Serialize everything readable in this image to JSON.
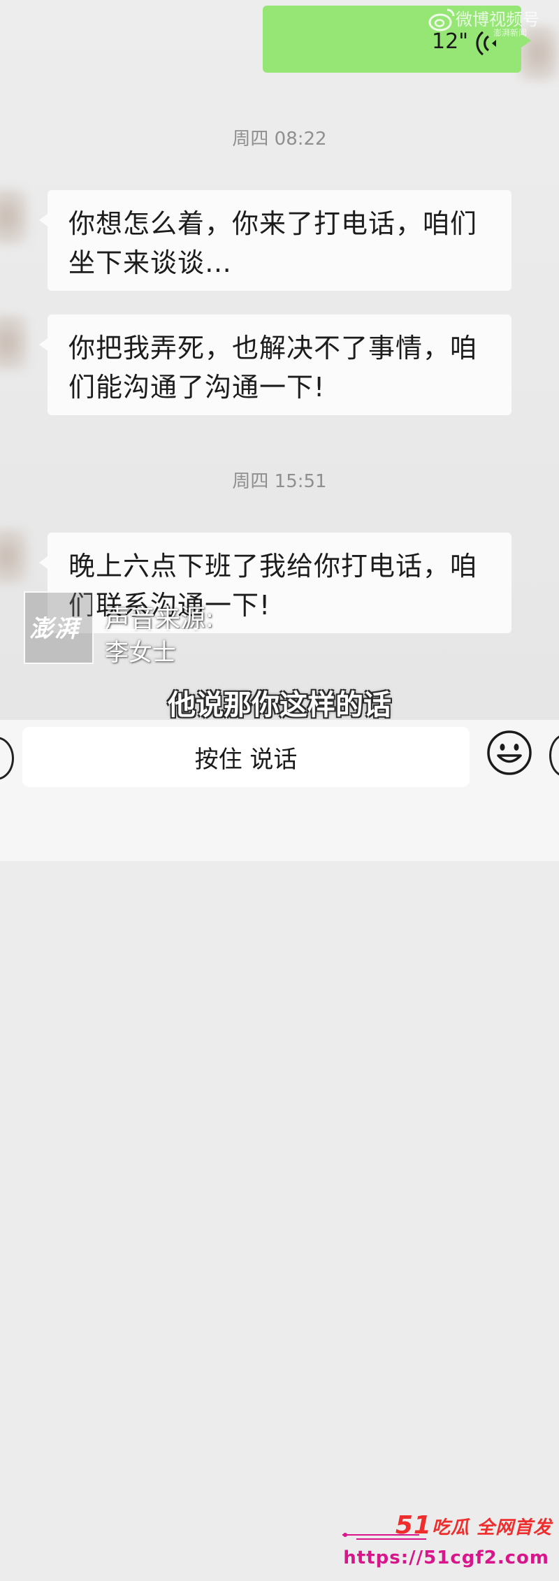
{
  "watermark": {
    "brand": "微博视频号",
    "sub": "澎湃新闻"
  },
  "voice_message": {
    "duration": "12\""
  },
  "messages": [
    {
      "time": "周四 08:22"
    },
    {
      "text": "你想怎么着，你来了打电话，咱们坐下来谈谈…"
    },
    {
      "text": "你把我弄死，也解决不了事情，咱们能沟通了沟通一下!"
    },
    {
      "time": "周四 15:51"
    },
    {
      "text": "晚上六点下班了我给你打电话，咱们联系沟通一下!"
    }
  ],
  "overlay": {
    "source_logo": "澎湃",
    "source_title": "声音来源:",
    "source_name": "李女士",
    "subtitle": "他说那你这样的话"
  },
  "input_bar": {
    "hold_to_talk_label": "按住 说话"
  },
  "promo": {
    "number": "51",
    "title": "吃瓜 全网首发",
    "url": "https://51cgf2.com"
  },
  "colors": {
    "sent_bubble": "#95e675",
    "received_bubble": "#fbfbfb",
    "background": "#ececec",
    "promo_red": "#ef2d2d",
    "promo_magenta": "#d8158a"
  },
  "icons": [
    "voice-wave-icon",
    "voice-toggle-icon",
    "emoji-icon",
    "plus-icon",
    "weibo-logo-icon"
  ]
}
